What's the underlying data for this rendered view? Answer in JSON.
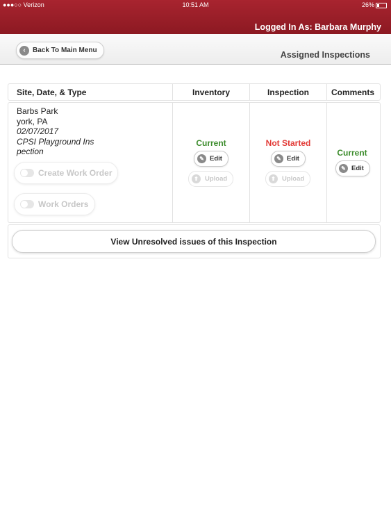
{
  "status_bar": {
    "carrier": "●●●○○ Verizon",
    "wifi": "✈",
    "time": "10:51 AM",
    "battery": "26%"
  },
  "header": {
    "logged_in": "Logged In As: Barbara Murphy"
  },
  "subheader": {
    "back_label": "Back To Main Menu",
    "title": "Assigned Inspections"
  },
  "table": {
    "headers": {
      "site": "Site, Date, & Type",
      "inventory": "Inventory",
      "inspection": "Inspection",
      "comments": "Comments"
    },
    "row": {
      "site_name": "Barbs Park",
      "location": "york, PA",
      "date": "02/07/2017",
      "type_line1": "CPSI Playground Ins",
      "type_line2": "pection",
      "create_work_order": "Create Work Order",
      "work_orders": "Work Orders",
      "inventory_status": "Current",
      "inspection_status": "Not Started",
      "comments_status": "Current",
      "edit_label": "Edit",
      "upload_label": "Upload"
    }
  },
  "view_issues": "View Unresolved issues of this Inspection",
  "colors": {
    "header_red": "#9e1f29",
    "status_green": "#3c8c2c",
    "status_red": "#e23b37"
  }
}
